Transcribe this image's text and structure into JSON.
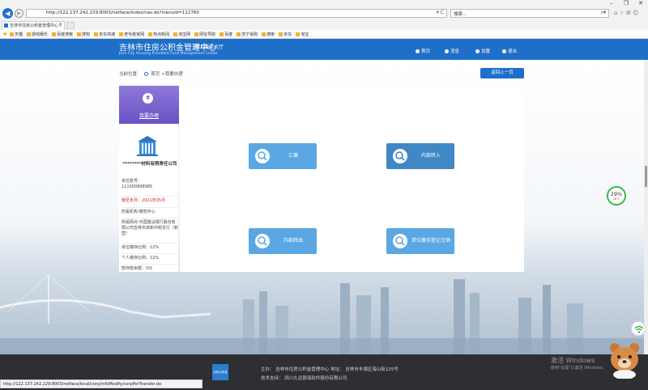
{
  "browser": {
    "url": "http://122.137.242.229:8003/netface/index/nav.do?menuid=112760",
    "search_placeholder": "搜索...",
    "tab_title": "吉林市住房公积金管理中心...",
    "favorites": [
      "天猫",
      "游戏娱乐",
      "百度搜索",
      "搜狗",
      "京东商城",
      "老毛桃官网",
      "热点新闻",
      "淘宝网",
      "网址导航",
      "百度",
      "苏宁易购",
      "搜索",
      "京东",
      "淘宝"
    ]
  },
  "header": {
    "title": "吉林市住房公积金管理中心",
    "subtitle": "网上服务大厅",
    "title_en": "JiLin City Housing Provident Fund Management Center",
    "nav": [
      "首页",
      "消息",
      "设置",
      "退出"
    ]
  },
  "breadcrumb": {
    "prefix": "当前位置:",
    "home": "首页",
    "current": ">我要办理"
  },
  "back_button": "返回上一页",
  "sidebar": {
    "heading": "我要办理",
    "company": "********材料有限责任公司",
    "unit_account_label": "单位账号:",
    "unit_account": "111000898985",
    "deadline": "缴至年月：2021年05月",
    "agency": "所属机构:缴管中心",
    "bank": "所属网点:中国建设银行股份有限公司吉林市高新中街支行（新营）",
    "unit_rate": "单位缴存比例：12%",
    "personal_rate": "个人缴存比例：12%",
    "suspended": "暂存款余额：0元"
  },
  "actions": [
    {
      "label": "汇缴",
      "icon": "search-icon"
    },
    {
      "label": "内部转入",
      "icon": "search-icon"
    },
    {
      "label": "内部转出",
      "icon": "search-icon"
    },
    {
      "label": "单位缴存登记注销",
      "icon": "search-icon"
    }
  ],
  "gauge": {
    "percent": "29%",
    "temp": "48°C"
  },
  "footer": {
    "host": "主办：  吉林市住房公积金管理中心  地址：  吉林市丰满区海山街225号",
    "support": "技术支持：  四川久远银海软件股份有限公司",
    "logo_text": "吉林公积金"
  },
  "status_url": "http://122.137.242.229:8003/netface/local/corp/infoModify/corpPerTransfer.do",
  "watermark": {
    "line1": "激活 Windows",
    "line2": "转到\"设置\"以激活 Windows。"
  }
}
